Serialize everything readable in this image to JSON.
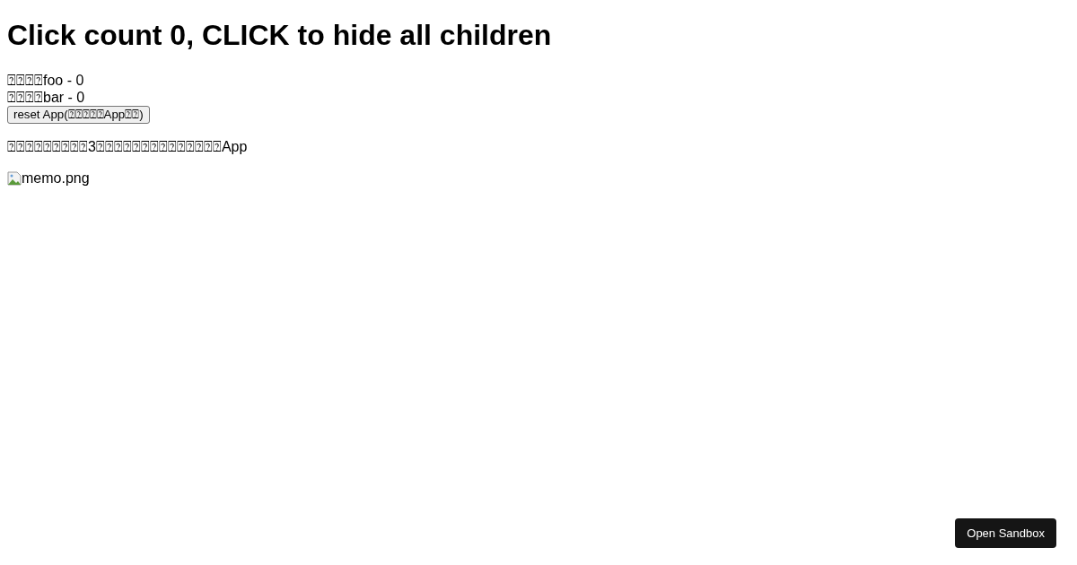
{
  "heading": "Click count 0, CLICK to hide all children",
  "children": [
    "⍰⍰⍰⍰foo - 0",
    "⍰⍰⍰⍰bar - 0"
  ],
  "reset_button": "reset App(⍰⍰⍰⍰⍰App⍰⍰)",
  "note": "⍰⍰⍰⍰⍰⍰⍰⍰⍰3⍰⍰⍰⍰⍰⍰⍰⍰⍰⍰⍰⍰⍰⍰App",
  "image": {
    "alt": "memo.png"
  },
  "open_sandbox_button": "Open Sandbox"
}
